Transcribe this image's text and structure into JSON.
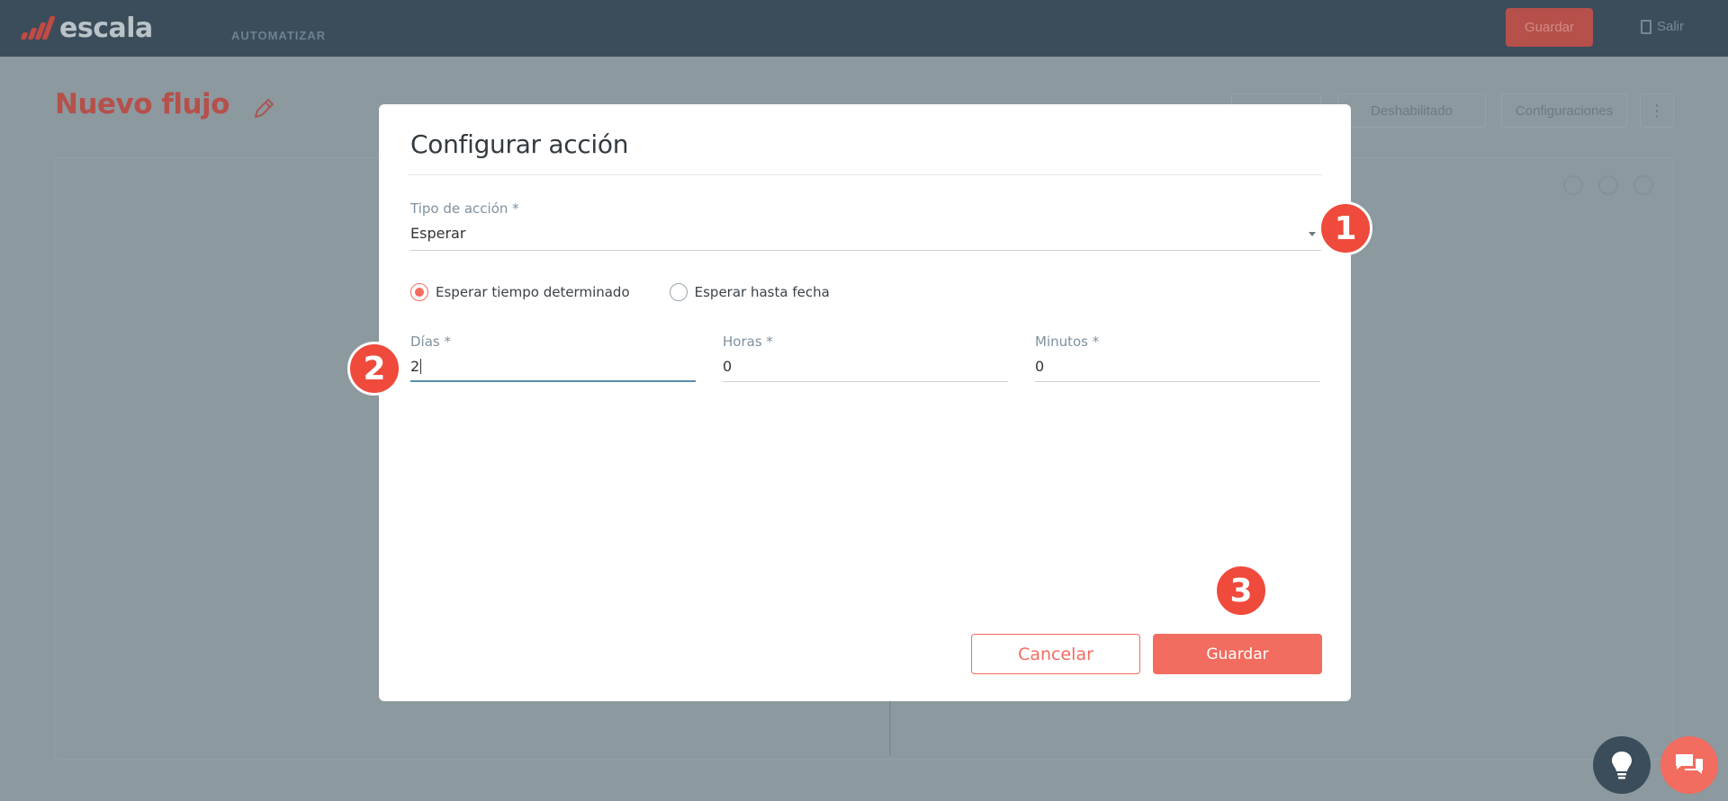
{
  "topbar": {
    "logo_text": "escala",
    "menu_label": "AUTOMATIZAR",
    "save_label": "Guardar",
    "exit_label": "Salir"
  },
  "page": {
    "title": "Nuevo flujo",
    "status_label": "Deshabilitado",
    "settings_label": "Configuraciones"
  },
  "modal": {
    "title": "Configurar acción",
    "action_type": {
      "label": "Tipo de acción *",
      "value": "Esperar"
    },
    "radios": [
      {
        "label": "Esperar tiempo determinado",
        "checked": true
      },
      {
        "label": "Esperar hasta fecha",
        "checked": false
      }
    ],
    "days": {
      "label": "Días *",
      "value": "2"
    },
    "hours": {
      "label": "Horas *",
      "value": "0"
    },
    "minutes": {
      "label": "Minutos *",
      "value": "0"
    },
    "cancel_label": "Cancelar",
    "save_label": "Guardar"
  },
  "markers": [
    "1",
    "2",
    "3"
  ],
  "colors": {
    "accent": "#f26c5f",
    "topbar": "#3b4d5a",
    "marker": "#ef4a3b",
    "active_underline": "#5b8cac"
  }
}
